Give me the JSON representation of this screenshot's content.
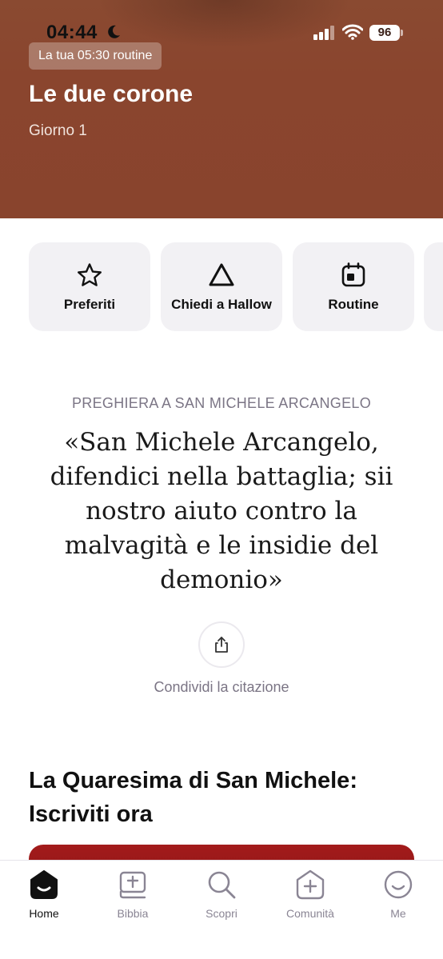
{
  "status_bar": {
    "time": "04:44",
    "battery": "96"
  },
  "header": {
    "routine_chip": "La tua 05:30 routine",
    "title": "Le due corone",
    "subtitle": "Giorno 1"
  },
  "quick_actions": [
    {
      "label": "Preferiti",
      "icon": "star-icon"
    },
    {
      "label": "Chiedi a Hallow",
      "icon": "triangle-icon"
    },
    {
      "label": "Routine",
      "icon": "calendar-icon"
    }
  ],
  "quote": {
    "eyebrow": "PREGHIERA A SAN MICHELE ARCANGELO",
    "text": "«San Michele Arcangelo, difendici nella battaglia; sii nostro aiuto contro la malvagità e le insidie del demonio»",
    "share_label": "Condividi la citazione"
  },
  "section": {
    "title": "La Quaresima di San Michele: Iscriviti ora"
  },
  "tabbar": {
    "items": [
      {
        "label": "Home",
        "icon": "home-icon",
        "active": true
      },
      {
        "label": "Bibbia",
        "icon": "bible-icon",
        "active": false
      },
      {
        "label": "Scopri",
        "icon": "search-icon",
        "active": false
      },
      {
        "label": "Comunità",
        "icon": "community-icon",
        "active": false
      },
      {
        "label": "Me",
        "icon": "profile-icon",
        "active": false
      }
    ]
  },
  "colors": {
    "header_bg": "#8a452e",
    "card_bg": "#f2f1f4",
    "promo_red": "#a31b1b",
    "muted_text": "#7b7585"
  }
}
